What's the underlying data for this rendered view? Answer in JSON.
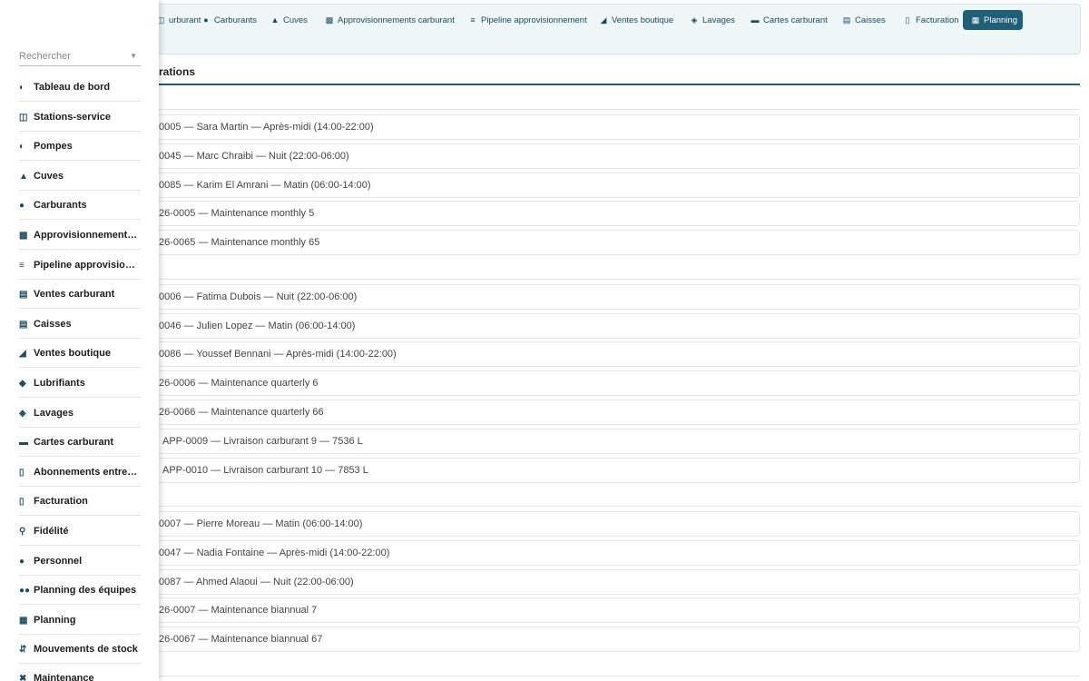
{
  "topnav": [
    {
      "label": "urburant",
      "icon": "fuel-pump-icon"
    },
    {
      "label": "Carburants",
      "icon": "droplet-icon"
    },
    {
      "label": "Cuves",
      "icon": "oil-can-icon"
    },
    {
      "label": "Approvisionnements carburant",
      "icon": "truck-icon"
    },
    {
      "label": "Pipeline approvisionnement",
      "icon": "list-icon"
    },
    {
      "label": "Ventes boutique",
      "icon": "basket-icon"
    },
    {
      "label": "Lavages",
      "icon": "car-icon"
    },
    {
      "label": "Cartes carburant",
      "icon": "credit-card-icon"
    },
    {
      "label": "Caisses",
      "icon": "cash-register-icon"
    },
    {
      "label": "Facturation",
      "icon": "invoice-icon"
    },
    {
      "label": "Planning",
      "icon": "calendar-icon",
      "active": true
    }
  ],
  "search": {
    "placeholder": "Rechercher"
  },
  "section": {
    "title": "rations"
  },
  "groups": [
    {
      "items": [
        "0005 — Sara Martin — Après-midi (14:00-22:00)",
        "0045 — Marc Chraibi — Nuit (22:00-06:00)",
        "0085 — Karim El Amrani — Matin (06:00-14:00)",
        "26-0005 — Maintenance monthly 5",
        "26-0065 — Maintenance monthly 65"
      ]
    },
    {
      "items": [
        "0006 — Fatima Dubois — Nuit (22:00-06:00)",
        "0046 — Julien Lopez — Matin (06:00-14:00)",
        "0086 — Youssef Bennani — Après-midi (14:00-22:00)",
        "26-0006 — Maintenance quarterly 6",
        "26-0066 — Maintenance quarterly 66",
        "APP-0009 — Livraison carburant 9 — 7536 L",
        "APP-0010 — Livraison carburant 10 — 7853 L"
      ]
    },
    {
      "items": [
        "0007 — Pierre Moreau — Matin (06:00-14:00)",
        "0047 — Nadia Fontaine — Après-midi (14:00-22:00)",
        "0087 — Ahmed Alaoui — Nuit (22:00-06:00)",
        "26-0007 — Maintenance biannual 7",
        "26-0067 — Maintenance biannual 67"
      ]
    }
  ],
  "sidebar": [
    {
      "label": "Tableau de bord",
      "icon": "dashboard-icon"
    },
    {
      "label": "Stations-service",
      "icon": "fuel-station-icon"
    },
    {
      "label": "Pompes",
      "icon": "gauge-icon"
    },
    {
      "label": "Cuves",
      "icon": "oil-can-icon"
    },
    {
      "label": "Carburants",
      "icon": "droplet-icon"
    },
    {
      "label": "Approvisionnements carburant",
      "icon": "truck-icon"
    },
    {
      "label": "Pipeline approvisionnement",
      "icon": "list-icon"
    },
    {
      "label": "Ventes carburant",
      "icon": "receipt-icon"
    },
    {
      "label": "Caisses",
      "icon": "cash-register-icon"
    },
    {
      "label": "Ventes boutique",
      "icon": "basket-icon"
    },
    {
      "label": "Lubrifiants",
      "icon": "oil-icon"
    },
    {
      "label": "Lavages",
      "icon": "car-icon"
    },
    {
      "label": "Cartes carburant",
      "icon": "credit-card-icon"
    },
    {
      "label": "Abonnements entreprise",
      "icon": "file-contract-icon"
    },
    {
      "label": "Facturation",
      "icon": "invoice-icon"
    },
    {
      "label": "Fidélité",
      "icon": "award-icon"
    },
    {
      "label": "Personnel",
      "icon": "user-icon"
    },
    {
      "label": "Planning des équipes",
      "icon": "users-icon"
    },
    {
      "label": "Planning",
      "icon": "calendar-icon"
    },
    {
      "label": "Mouvements de stock",
      "icon": "arrows-icon"
    },
    {
      "label": "Maintenance",
      "icon": "tools-icon"
    }
  ]
}
